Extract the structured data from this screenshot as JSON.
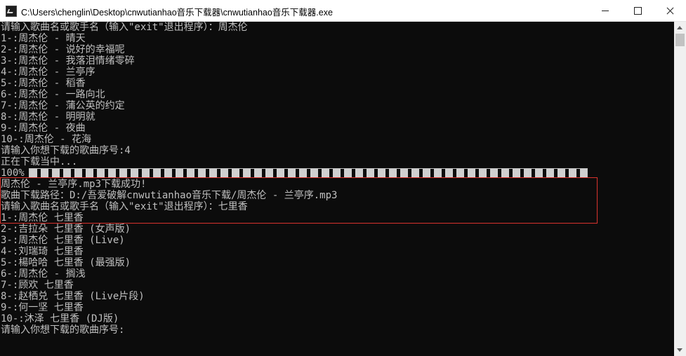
{
  "window": {
    "title": "C:\\Users\\chenglin\\Desktop\\cnwutianhao音乐下载器\\cnwutianhao音乐下载器.exe",
    "icon": "console-app-icon"
  },
  "console": {
    "block1": [
      "请输入歌曲名或歌手名（输入\"exit\"退出程序）：周杰伦",
      "1-:周杰伦 - 晴天",
      "2-:周杰伦 - 说好的幸福呢",
      "3-:周杰伦 - 我落泪情绪零碎",
      "4-:周杰伦 - 兰亭序",
      "5-:周杰伦 - 稻香",
      "6-:周杰伦 - 一路向北",
      "7-:周杰伦 - 蒲公英的约定",
      "8-:周杰伦 - 明明就",
      "9-:周杰伦 - 夜曲",
      "10-:周杰伦 - 花海",
      "请输入你想下载的歌曲序号:4"
    ],
    "download": {
      "status": "正在下载当中...",
      "progress_label": "100%",
      "progress": 1.0,
      "success": "周杰伦 - 兰亭序.mp3下载成功!",
      "path": "歌曲下载路径：D:/吾爱破解cnwutianhao音乐下载/周杰伦 - 兰亭序.mp3"
    },
    "block2": [
      "请输入歌曲名或歌手名（输入\"exit\"退出程序）：七里香",
      "1-:周杰伦 七里香",
      "2-:吉拉朵 七里香 (女声版)",
      "3-:周杰伦 七里香 (Live)",
      "4-:刘瑞琦 七里香",
      "5-:楊哈哈 七里香 (最强版)",
      "6-:周杰伦 - 搁浅",
      "7-:顾欢 七里香",
      "8-:赵栖兑 七里香 (Live片段)",
      "9-:何一坚 七里香",
      "10-:沐泽 七里香 (DJ版)",
      "请输入你想下载的歌曲序号:"
    ]
  },
  "colors": {
    "console_bg": "#0c0c0c",
    "console_text": "#c0c0c0",
    "highlight_border": "#d9332d"
  }
}
